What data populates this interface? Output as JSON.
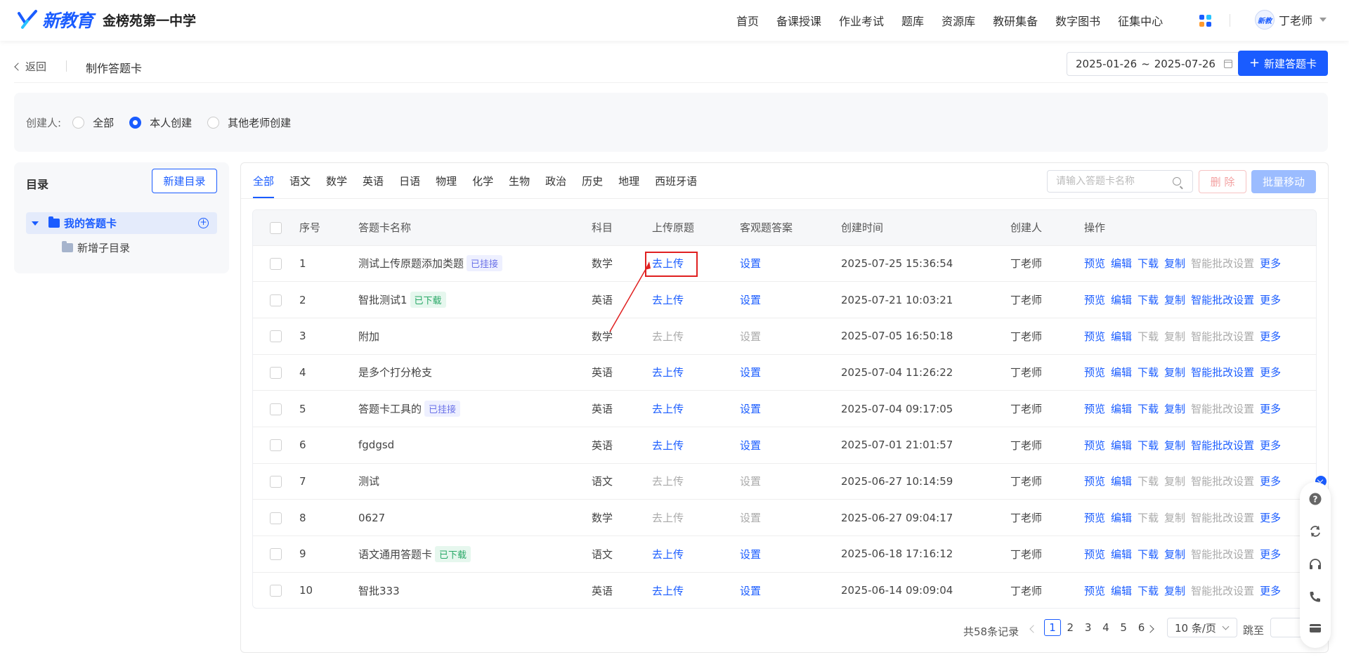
{
  "header": {
    "brand": "新教育",
    "school": "金榜苑第一中学",
    "nav": [
      "首页",
      "备课授课",
      "作业考试",
      "题库",
      "资源库",
      "教研集备",
      "数字图书",
      "征集中心"
    ],
    "user_name": "丁老师",
    "avatar_text": "新教",
    "apps_colors": [
      "#1a5cff",
      "#27c3ff",
      "#ff9a2e",
      "#1a5cff"
    ]
  },
  "subheader": {
    "back_label": "返回",
    "title": "制作答题卡",
    "date_start": "2025-01-26",
    "date_sep": "~",
    "date_end": "2025-07-26",
    "new_card_label": "新建答题卡"
  },
  "filter": {
    "label": "创建人:",
    "options": [
      "全部",
      "本人创建",
      "其他老师创建"
    ],
    "selected": "本人创建"
  },
  "sidebar": {
    "title": "目录",
    "new_dir_label": "新建目录",
    "root_label": "我的答题卡",
    "child_label": "新增子目录"
  },
  "tabs": [
    "全部",
    "语文",
    "数学",
    "英语",
    "日语",
    "物理",
    "化学",
    "生物",
    "政治",
    "历史",
    "地理",
    "西班牙语"
  ],
  "toolbar": {
    "search_placeholder": "请输入答题卡名称",
    "delete_label": "删 除",
    "batch_move_label": "批量移动"
  },
  "table": {
    "headers": [
      "序号",
      "答题卡名称",
      "科目",
      "上传原题",
      "客观题答案",
      "创建时间",
      "创建人",
      "操作"
    ],
    "rows": [
      {
        "no": "1",
        "name": "测试上传原题添加类题",
        "tag": "已挂接",
        "tag_type": "attached",
        "subject": "数学",
        "upload": "去上传",
        "upload_enabled": true,
        "answer": "设置",
        "answer_enabled": true,
        "time": "2025-07-25 15:36:54",
        "creator": "丁老师",
        "download_enabled": true,
        "copy_enabled": true,
        "smart_enabled": false
      },
      {
        "no": "2",
        "name": "智批测试1",
        "tag": "已下载",
        "tag_type": "downloaded",
        "subject": "英语",
        "upload": "去上传",
        "upload_enabled": true,
        "answer": "设置",
        "answer_enabled": true,
        "time": "2025-07-21 10:03:21",
        "creator": "丁老师",
        "download_enabled": true,
        "copy_enabled": true,
        "smart_enabled": true
      },
      {
        "no": "3",
        "name": "附加",
        "tag": "",
        "tag_type": "",
        "subject": "数学",
        "upload": "去上传",
        "upload_enabled": false,
        "answer": "设置",
        "answer_enabled": false,
        "time": "2025-07-05 16:50:18",
        "creator": "丁老师",
        "download_enabled": false,
        "copy_enabled": false,
        "smart_enabled": false
      },
      {
        "no": "4",
        "name": "是多个打分枪支",
        "tag": "",
        "tag_type": "",
        "subject": "英语",
        "upload": "去上传",
        "upload_enabled": true,
        "answer": "设置",
        "answer_enabled": true,
        "time": "2025-07-04 11:26:22",
        "creator": "丁老师",
        "download_enabled": true,
        "copy_enabled": true,
        "smart_enabled": true
      },
      {
        "no": "5",
        "name": "答题卡工具的",
        "tag": "已挂接",
        "tag_type": "attached",
        "subject": "英语",
        "upload": "去上传",
        "upload_enabled": true,
        "answer": "设置",
        "answer_enabled": true,
        "time": "2025-07-04 09:17:05",
        "creator": "丁老师",
        "download_enabled": true,
        "copy_enabled": true,
        "smart_enabled": false
      },
      {
        "no": "6",
        "name": "fgdgsd",
        "tag": "",
        "tag_type": "",
        "subject": "英语",
        "upload": "去上传",
        "upload_enabled": true,
        "answer": "设置",
        "answer_enabled": true,
        "time": "2025-07-01 21:01:57",
        "creator": "丁老师",
        "download_enabled": true,
        "copy_enabled": true,
        "smart_enabled": true
      },
      {
        "no": "7",
        "name": "测试",
        "tag": "",
        "tag_type": "",
        "subject": "语文",
        "upload": "去上传",
        "upload_enabled": false,
        "answer": "设置",
        "answer_enabled": false,
        "time": "2025-06-27 10:14:59",
        "creator": "丁老师",
        "download_enabled": false,
        "copy_enabled": false,
        "smart_enabled": false
      },
      {
        "no": "8",
        "name": "0627",
        "tag": "",
        "tag_type": "",
        "subject": "数学",
        "upload": "去上传",
        "upload_enabled": false,
        "answer": "设置",
        "answer_enabled": false,
        "time": "2025-06-27 09:04:17",
        "creator": "丁老师",
        "download_enabled": false,
        "copy_enabled": false,
        "smart_enabled": false
      },
      {
        "no": "9",
        "name": "语文通用答题卡",
        "tag": "已下载",
        "tag_type": "downloaded",
        "subject": "语文",
        "upload": "去上传",
        "upload_enabled": true,
        "answer": "设置",
        "answer_enabled": true,
        "time": "2025-06-18 17:16:12",
        "creator": "丁老师",
        "download_enabled": true,
        "copy_enabled": true,
        "smart_enabled": false
      },
      {
        "no": "10",
        "name": "智批333",
        "tag": "",
        "tag_type": "",
        "subject": "英语",
        "upload": "去上传",
        "upload_enabled": true,
        "answer": "设置",
        "answer_enabled": true,
        "time": "2025-06-14 09:09:04",
        "creator": "丁老师",
        "download_enabled": true,
        "copy_enabled": true,
        "smart_enabled": false
      }
    ],
    "ops_labels": {
      "preview": "预览",
      "edit": "编辑",
      "download": "下载",
      "copy": "复制",
      "smart": "智能批改设置",
      "more": "更多"
    }
  },
  "pagination": {
    "total": "共58条记录",
    "pages": [
      "1",
      "2",
      "3",
      "4",
      "5",
      "6"
    ],
    "current": "1",
    "page_size": "10 条/页",
    "goto_label": "跳至"
  },
  "colors": {
    "primary": "#1a5cff",
    "highlight": "#e02020"
  }
}
